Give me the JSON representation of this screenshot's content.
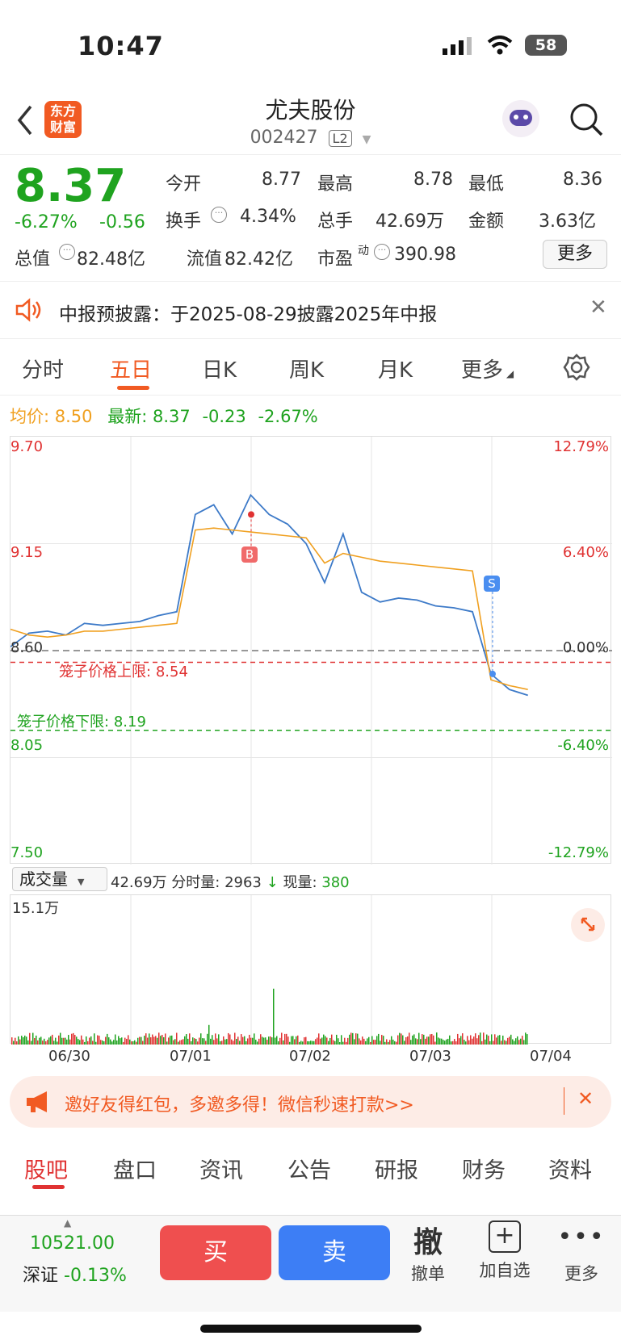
{
  "status": {
    "time": "10:47",
    "battery": "58"
  },
  "nav": {
    "title": "尤夫股份",
    "code": "002427",
    "level": "L2",
    "logo": "东方财富"
  },
  "quote": {
    "price": "8.37",
    "change_pct": "-6.27%",
    "change": "-0.56",
    "open_label": "今开",
    "open": "8.77",
    "high_label": "最高",
    "high": "8.78",
    "low_label": "最低",
    "low": "8.36",
    "turnover_label": "换手",
    "turnover": "4.34%",
    "volume_label": "总手",
    "volume": "42.69万",
    "amount_label": "金额",
    "amount": "3.63亿",
    "mktcap_label": "总值",
    "mktcap": "82.48亿",
    "float_label": "流值",
    "float": "82.42亿",
    "pe_label": "市盈",
    "pe_sup": "动",
    "pe": "390.98",
    "more": "更多"
  },
  "notice": {
    "text": "中报预披露：于2025-08-29披露2025年中报"
  },
  "tabs": [
    "分时",
    "五日",
    "日K",
    "周K",
    "月K",
    "更多"
  ],
  "info_line": {
    "avg_label": "均价:",
    "avg": "8.50",
    "latest_label": "最新:",
    "latest": "8.37",
    "chg": "-0.23",
    "pct": "-2.67%"
  },
  "chart_data": {
    "type": "line",
    "title": "",
    "xlabel": "",
    "ylabel": "",
    "x": [
      "06/30",
      "07/01",
      "07/02",
      "07/03",
      "07/04"
    ],
    "ylim": [
      7.5,
      9.7
    ],
    "y_ticks": [
      "9.70",
      "9.15",
      "8.60",
      "8.05",
      "7.50"
    ],
    "right_ticks": [
      "12.79%",
      "6.40%",
      "0.00%",
      "-6.40%",
      "-12.79%"
    ],
    "series": [
      {
        "name": "",
        "values": [
          8.62,
          8.69,
          8.7,
          8.68,
          8.74,
          8.73,
          8.74,
          8.75,
          8.78,
          8.8,
          9.3,
          9.35,
          9.2,
          9.4,
          9.3,
          9.25,
          9.15,
          8.95,
          9.2,
          8.9,
          8.85,
          8.87,
          8.86,
          8.83,
          8.82,
          8.8,
          8.48,
          8.4,
          8.37
        ]
      },
      {
        "name": "",
        "values": [
          8.71,
          8.68,
          8.67,
          8.68,
          8.7,
          8.7,
          8.71,
          8.72,
          8.73,
          8.74,
          9.22,
          9.23,
          9.22,
          9.21,
          9.2,
          9.19,
          9.18,
          9.05,
          9.1,
          9.08,
          9.06,
          9.05,
          9.04,
          9.03,
          9.02,
          9.01,
          8.45,
          8.42,
          8.4
        ]
      }
    ],
    "limit_up_label": "笼子价格上限:",
    "limit_up": "8.54",
    "limit_low_label": "笼子价格下限:",
    "limit_low": "8.19",
    "markers": [
      {
        "label": "B"
      },
      {
        "label": "S"
      }
    ]
  },
  "volume": {
    "selector": "成交量",
    "total": "42.69万",
    "tick_label": "分时量:",
    "tick": "2963",
    "now_label": "现量:",
    "now": "380",
    "max": "15.1万"
  },
  "promo": {
    "text": "邀好友得红包，多邀多得！微信秒速打款>>"
  },
  "bottom_tabs": [
    "股吧",
    "盘口",
    "资讯",
    "公告",
    "研报",
    "财务",
    "资料"
  ],
  "toolbar": {
    "index_value": "10521.00",
    "index_name": "深证",
    "index_pct": "-0.13%",
    "buy": "买",
    "sell": "卖",
    "cancel_big": "撤",
    "cancel": "撤单",
    "watch": "加自选",
    "more": "更多"
  },
  "colors": {
    "accent": "#f15a22",
    "up": "#e03232",
    "down": "#1fa31f",
    "avg": "#f0a020",
    "line": "#3d7ac8"
  }
}
